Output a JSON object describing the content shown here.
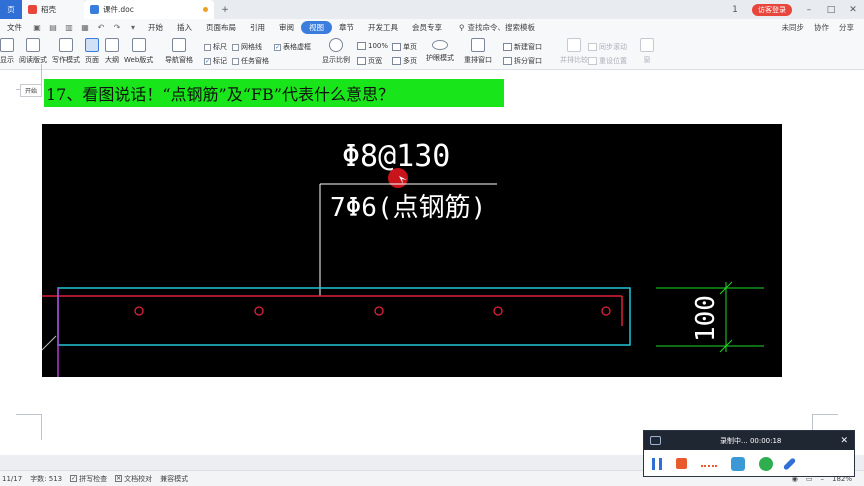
{
  "tabs": {
    "left_tab": "页",
    "wps": "稻壳",
    "doc": "课件.doc",
    "add": "+"
  },
  "top_right": {
    "badge": "1",
    "visitor": "访客登录"
  },
  "menu": {
    "file": "文件",
    "items": [
      "开始",
      "插入",
      "页面布局",
      "引用",
      "审阅",
      "视图",
      "章节",
      "开发工具",
      "会员专享"
    ],
    "active": "视图",
    "search": "查找命令、搜索模板",
    "right": [
      "未同步",
      "协作",
      "分享"
    ]
  },
  "ribbon": {
    "buttons": [
      "显示",
      "阅读版式",
      "写作模式",
      "页面",
      "大纲",
      "Web版式",
      "导航窗格",
      "显示比例",
      "护眼模式",
      "重排窗口",
      "并排比较",
      "窗"
    ],
    "checks": [
      {
        "label": "标尺",
        "checked": false
      },
      {
        "label": "网格线",
        "checked": false
      },
      {
        "label": "表格虚框",
        "checked": true
      },
      {
        "label": "标记",
        "checked": true
      },
      {
        "label": "任务窗格",
        "checked": false
      }
    ],
    "small": [
      "100%",
      "单页",
      "页宽",
      "多页",
      "新建窗口",
      "拆分窗口",
      "同步滚动",
      "重设位置"
    ]
  },
  "tooltip": "开始",
  "doc": {
    "title": "17、看图说话！“点钢筋”及“FB”代表什么意思？"
  },
  "cad": {
    "top_label": "Φ8@130",
    "mid_label": "7Φ6(点钢筋)",
    "dim_label": "100"
  },
  "status": {
    "page": "11/17",
    "words": "字数: 513",
    "spell": "拼写检查",
    "proof": "文档校对",
    "compat": "兼容模式",
    "zoom": "182%"
  },
  "recorder": {
    "title": "录制中... 00:00:18"
  },
  "colors": {
    "accent": "#3b7ddd",
    "highlight": "#18e51a",
    "rec_stop": "#e85a2e"
  }
}
